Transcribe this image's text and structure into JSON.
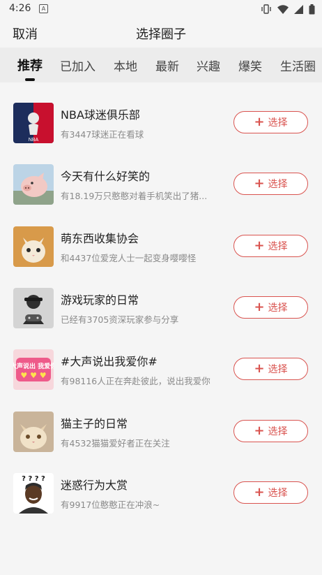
{
  "status_bar": {
    "time": "4:26",
    "a_badge": "A"
  },
  "header": {
    "cancel_label": "取消",
    "title": "选择圈子"
  },
  "tabs": [
    {
      "label": "推荐",
      "active": true
    },
    {
      "label": "已加入"
    },
    {
      "label": "本地"
    },
    {
      "label": "最新"
    },
    {
      "label": "兴趣"
    },
    {
      "label": "爆笑"
    },
    {
      "label": "生活圈"
    }
  ],
  "select_label": "选择",
  "circles": [
    {
      "name": "NBA球迷俱乐部",
      "desc": "有3447球迷正在看球",
      "avatar_icon": "nba-logo-icon",
      "avatar_text": "NBA"
    },
    {
      "name": "今天有什么好笑的",
      "desc": "有18.19万只憨憨对着手机笑出了猪...",
      "avatar_icon": "pig-icon"
    },
    {
      "name": "萌东西收集协会",
      "desc": "和4437位爱宠人士一起变身嘤嘤怪",
      "avatar_icon": "kitten-icon"
    },
    {
      "name": "游戏玩家的日常",
      "desc": "已经有3705资深玩家参与分享",
      "avatar_icon": "gamer-icon"
    },
    {
      "name": "#大声说出我爱你#",
      "desc": "有98116人正在奔赴彼此，说出我爱你",
      "avatar_icon": "love-text-icon",
      "avatar_text": "大声说出 我爱你"
    },
    {
      "name": "猫主子的日常",
      "desc": "有4532猫猫爱好者正在关注",
      "avatar_icon": "cat-icon"
    },
    {
      "name": "迷惑行为大赏",
      "desc": "有9917位憨憨正在冲浪~",
      "avatar_icon": "confused-man-icon",
      "avatar_text": "? ? ? ?"
    }
  ],
  "colors": {
    "accent": "#d9534f",
    "background": "#f5f5f5",
    "tabs_bg": "#ececec"
  }
}
